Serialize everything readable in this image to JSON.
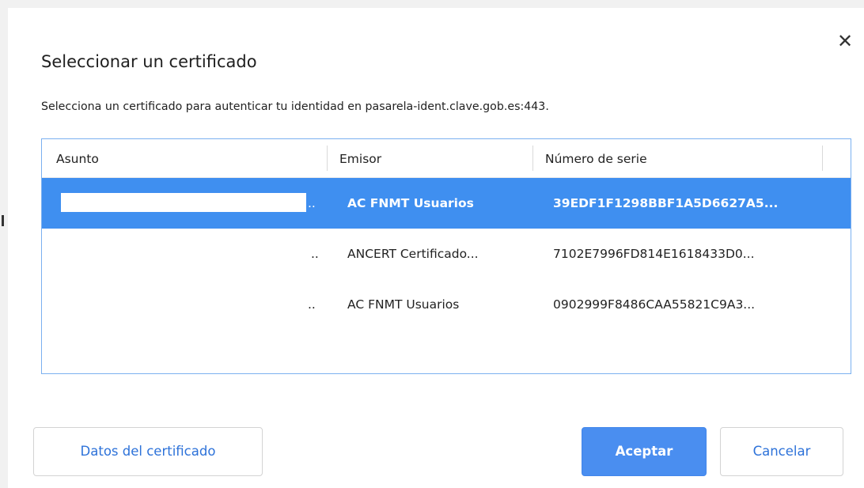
{
  "dialog": {
    "title": "Seleccionar un certificado",
    "subtitle": "Selecciona un certificado para autenticar tu identidad en pasarela-ident.clave.gob.es:443.",
    "close_glyph": "✕"
  },
  "table": {
    "headers": {
      "subject": "Asunto",
      "issuer": "Emisor",
      "serial": "Número de serie"
    },
    "rows": [
      {
        "subject": "..",
        "issuer": "AC FNMT Usuarios",
        "serial": "39EDF1F1298BBF1A5D6627A5...",
        "selected": true
      },
      {
        "subject": "..",
        "issuer": "ANCERT Certificado...",
        "serial": "7102E7996FD814E1618433D0...",
        "selected": false
      },
      {
        "subject": "..",
        "issuer": "AC FNMT Usuarios",
        "serial": "0902999F8486CAA55821C9A3...",
        "selected": false
      }
    ]
  },
  "buttons": {
    "details": "Datos del certificado",
    "accept": "Aceptar",
    "cancel": "Cancelar"
  },
  "colors": {
    "accent": "#4a8ef0",
    "selection": "#3f8ff0",
    "link_text": "#2d72d9"
  },
  "icons": {
    "close": "close-icon"
  }
}
